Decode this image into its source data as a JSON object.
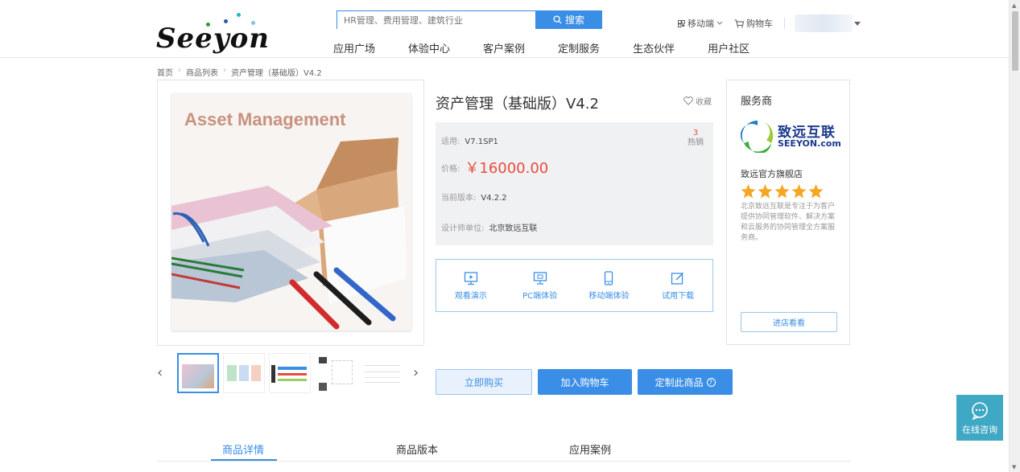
{
  "header": {
    "logo_text": "Seeyon",
    "search_placeholder": "HR管理、费用管理、建筑行业",
    "search_button": "搜索",
    "nav": [
      "应用广场",
      "体验中心",
      "客户案例",
      "定制服务",
      "生态伙伴",
      "用户社区"
    ],
    "mobile_label": "移动端",
    "cart_label": "购物车"
  },
  "breadcrumb": [
    "首页",
    "商品列表",
    "资产管理（基础版）V4.2"
  ],
  "product": {
    "image_title": "Asset Management",
    "title": "资产管理（基础版）V4.2",
    "favorite_label": "收藏",
    "hot_count": "3",
    "hot_label": "热销",
    "applicable_label": "适用:",
    "applicable_value": "V7.1SP1",
    "price_label": "价格:",
    "price_value": "￥16000.00",
    "version_label": "当前版本:",
    "version_value": "V4.2.2",
    "designer_label": "设计师单位:",
    "designer_value": "北京致远互联"
  },
  "experience": [
    {
      "label": "观看演示",
      "icon": "play-icon"
    },
    {
      "label": "PC端体验",
      "icon": "monitor-icon"
    },
    {
      "label": "移动端体验",
      "icon": "mobile-icon"
    },
    {
      "label": "试用下载",
      "icon": "edit-icon"
    }
  ],
  "actions": {
    "buy": "立即购买",
    "cart": "加入购物车",
    "customize": "定制此商品"
  },
  "vendor": {
    "heading": "服务商",
    "logo_cn": "致远互联",
    "logo_en": "SEEYON.com",
    "shop_name": "致远官方旗舰店",
    "rating": 5,
    "description": "北京致远互联是专注于为客户提供协同管理软件、解决方案和云服务的协同管理全方案服务商。",
    "enter_label": "进店看看"
  },
  "tabs": [
    "商品详情",
    "商品版本",
    "应用案例"
  ],
  "consult_label": "在线咨询",
  "colors": {
    "accent": "#3a8ee6",
    "price": "#e94b3c",
    "star": "#f5a623",
    "consult": "#3fa8c4"
  }
}
